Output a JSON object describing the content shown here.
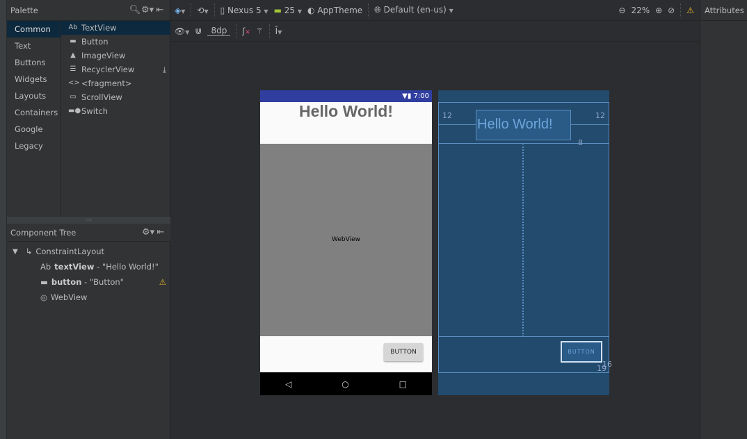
{
  "palette": {
    "title": "Palette",
    "categories": [
      "Common",
      "Text",
      "Buttons",
      "Widgets",
      "Layouts",
      "Containers",
      "Google",
      "Legacy"
    ],
    "items": [
      {
        "label": "TextView",
        "icon": "ab-text-icon"
      },
      {
        "label": "Button",
        "icon": "button-icon"
      },
      {
        "label": "ImageView",
        "icon": "image-icon"
      },
      {
        "label": "RecyclerView",
        "icon": "list-icon"
      },
      {
        "label": "<fragment>",
        "icon": "code-icon"
      },
      {
        "label": "ScrollView",
        "icon": "scroll-icon"
      },
      {
        "label": "Switch",
        "icon": "switch-icon"
      }
    ],
    "ab": "Ab"
  },
  "tree": {
    "title": "Component Tree",
    "root": "ConstraintLayout",
    "nodes": [
      {
        "id": "textView",
        "desc": " - \"Hello World!\""
      },
      {
        "id": "button",
        "desc": " - \"Button\""
      },
      {
        "id": "",
        "desc": "WebView"
      }
    ]
  },
  "toolbar": {
    "device": "Nexus 5",
    "api": "25",
    "theme": "AppTheme",
    "locale": "Default (en-us)",
    "zoom": "22%",
    "margin": "8dp"
  },
  "attributes": {
    "title": "Attributes"
  },
  "phone": {
    "time": "7:00",
    "title": "Hello World!",
    "webview": "WebView",
    "button": "BUTTON"
  },
  "blueprint": {
    "title": "Hello World!",
    "button": "BUTTON",
    "m_left": "12",
    "m_right": "12",
    "m_bottom": "8",
    "m_btn_right": "16",
    "m_btn_bottom": "19"
  },
  "colors": {
    "status_bar": "#303f9f",
    "webview": "#808080",
    "blueprint": "#234b6d",
    "warning": "#f0b429",
    "selection": "#0d293e"
  }
}
